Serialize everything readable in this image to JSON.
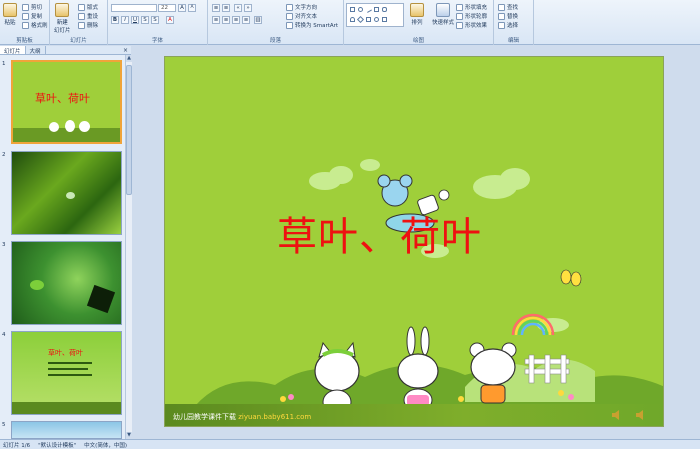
{
  "ribbon": {
    "clipboard": {
      "group": "剪贴板",
      "paste": "粘贴",
      "cut": "剪切",
      "copy": "复制",
      "format_painter": "格式刷"
    },
    "slides": {
      "group": "幻灯片",
      "new_slide": "新建\n幻灯片",
      "layout": "版式",
      "reset": "重设",
      "delete": "删除"
    },
    "font": {
      "group": "字体",
      "font_size": "22",
      "grow": "A",
      "shrink": "A"
    },
    "paragraph": {
      "group": "段落",
      "text_direction": "文字方向",
      "align_text": "对齐文本",
      "smartart": "转换为 SmartArt"
    },
    "drawing": {
      "group": "绘图",
      "arrange": "排列",
      "quick_styles": "快速样式",
      "shape_fill": "形状填充",
      "shape_outline": "形状轮廓",
      "shape_effects": "形状效果"
    },
    "editing": {
      "group": "编辑",
      "find": "查找",
      "replace": "替换",
      "select": "选择"
    }
  },
  "pane": {
    "tab_slides": "幻灯片",
    "tab_outline": "大纲",
    "close": "×"
  },
  "thumbnails": [
    {
      "num": "1",
      "title": "草叶、荷叶"
    },
    {
      "num": "2",
      "title": ""
    },
    {
      "num": "3",
      "title": ""
    },
    {
      "num": "4",
      "title": "草叶、荷叶"
    },
    {
      "num": "5",
      "title": ""
    }
  ],
  "slide": {
    "title": "草叶、荷叶",
    "footer_text": "幼儿园教学课件下载",
    "footer_url": "ziyuan.baby611.com"
  },
  "status": {
    "slide_count": "幻灯片 1/6",
    "theme": "\"默认设计模板\"",
    "language": "中文(简体，中国)"
  },
  "colors": {
    "slide_bg": "#9fcf3a",
    "title": "#ee1111",
    "selected_thumb": "#f0a43a"
  }
}
